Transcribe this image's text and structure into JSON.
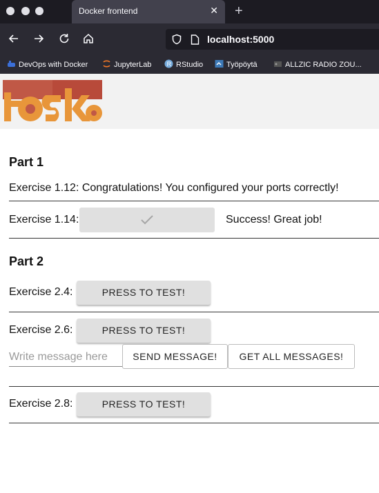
{
  "browser": {
    "tab_title": "Docker frontend",
    "tab_close": "✕",
    "new_tab": "+",
    "url": "localhost:5000",
    "bookmarks": [
      {
        "label": "DevOps with Docker"
      },
      {
        "label": "JupyterLab"
      },
      {
        "label": "RStudio"
      },
      {
        "label": "Työpöytä"
      },
      {
        "label": "ALLZIC RADIO ZOU..."
      }
    ]
  },
  "app": {
    "logo_text": "toska",
    "part1": {
      "heading": "Part 1",
      "ex112": "Exercise 1.12: Congratulations! You configured your ports correctly!",
      "ex114_label": "Exercise 1.14:",
      "ex114_status": "Success! Great job!"
    },
    "part2": {
      "heading": "Part 2",
      "ex24_label": "Exercise 2.4:",
      "ex26_label": "Exercise 2.6:",
      "ex28_label": "Exercise 2.8:",
      "test_button": "PRESS TO TEST!",
      "message_placeholder": "Write message here",
      "send_button": "SEND MESSAGE!",
      "get_all_button": "GET ALL MESSAGES!"
    }
  },
  "colors": {
    "logo_red": "#c0392b",
    "logo_orange": "#e8963a",
    "button_grey": "#e0e0e0"
  }
}
